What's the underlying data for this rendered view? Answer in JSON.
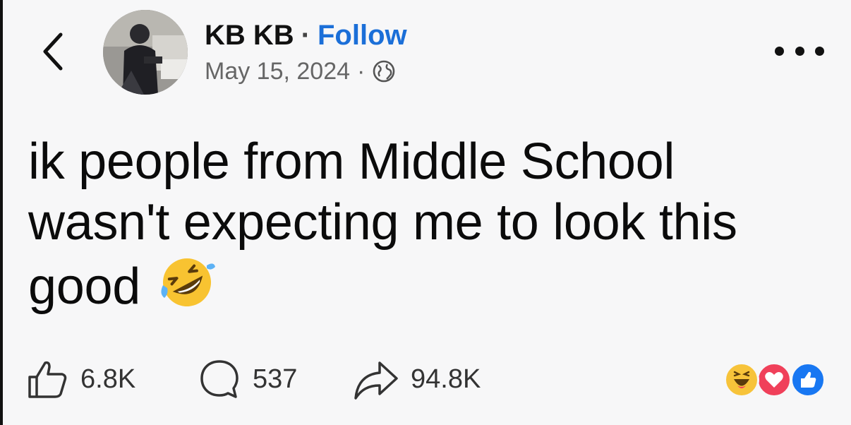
{
  "header": {
    "author": "KB KB",
    "separator": "·",
    "follow_label": "Follow",
    "date": "May 15, 2024",
    "meta_separator": "·",
    "privacy_icon": "globe-icon",
    "back_icon": "chevron-left-icon",
    "more_icon": "more-horizontal-icon"
  },
  "post": {
    "text": "ik people from Middle School wasn't expecting me to look this good",
    "emoji": "rolling-on-the-floor-laughing-emoji"
  },
  "actions": {
    "likes": "6.8K",
    "comments": "537",
    "shares": "94.8K"
  },
  "reactions": [
    "haha",
    "love",
    "like"
  ],
  "colors": {
    "follow": "#1b6fd8",
    "love": "#f0405a",
    "like": "#1877f2",
    "haha": "#f7c33a",
    "background": "#f7f7f8"
  }
}
